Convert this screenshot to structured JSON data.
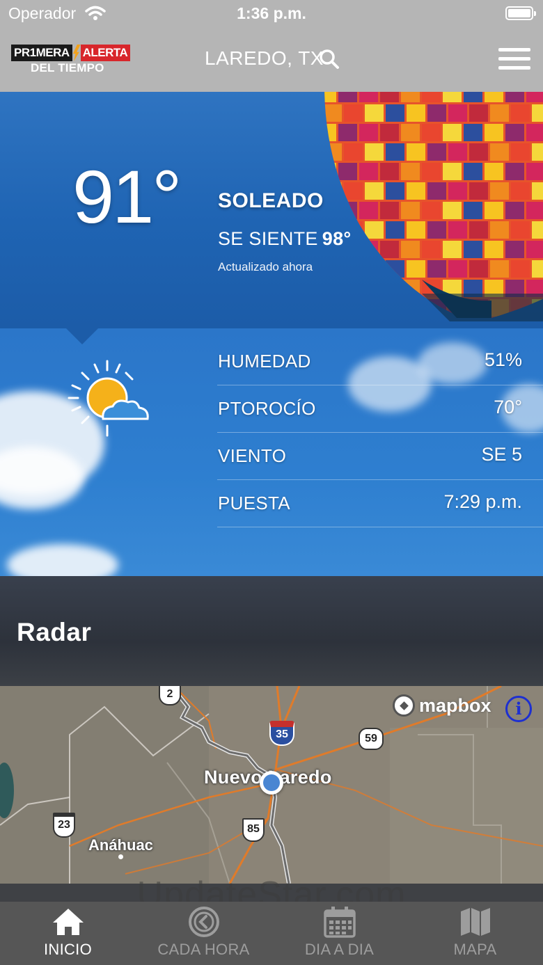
{
  "status_bar": {
    "carrier": "Operador",
    "time": "1:36 p.m."
  },
  "header": {
    "logo_line1_a": "PR1MERA",
    "logo_line1_b": "ALERTA",
    "logo_line2": "DEL TIEMPO",
    "city": "LAREDO, TX",
    "menu_icon": "hamburger-menu-icon",
    "search_icon": "search-icon"
  },
  "current": {
    "temperature": "91°",
    "condition": "SOLEADO",
    "feels_like_label": "SE SIENTE",
    "feels_like_value": "98°",
    "updated": "Actualizado ahora",
    "icon": "partly-sunny-icon"
  },
  "details": [
    {
      "label": "HUMEDAD",
      "value": "51%"
    },
    {
      "label": "PTOROCÍO",
      "value": "70°"
    },
    {
      "label": "VIENTO",
      "value": "SE 5"
    },
    {
      "label": "PUESTA",
      "value": "7:29 p.m."
    }
  ],
  "radar": {
    "title": "Radar",
    "map": {
      "attribution": "mapbox",
      "city_label": "Nuevo Laredo",
      "town_label": "Anáhuac",
      "shields": [
        "2",
        "35",
        "59",
        "23",
        "85"
      ]
    }
  },
  "watermark": "UpdateStar.com",
  "tabs": [
    {
      "label": "INICIO",
      "icon": "home-icon",
      "active": true
    },
    {
      "label": "CADA HORA",
      "icon": "clock-icon",
      "active": false
    },
    {
      "label": "DIA A DIA",
      "icon": "calendar-icon",
      "active": false
    },
    {
      "label": "MAPA",
      "icon": "map-icon",
      "active": false
    }
  ],
  "colors": {
    "header": "#b5b5b5",
    "sky": "#2b76c9",
    "tabbar": "#565656",
    "logo_red": "#d8262b",
    "logo_orange": "#f3a21b"
  }
}
